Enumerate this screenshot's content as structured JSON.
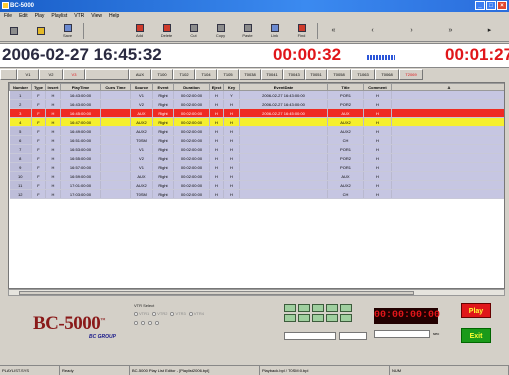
{
  "window": {
    "title": "BC-5000",
    "app_icon": "app-icon",
    "controls": [
      "_",
      "□",
      "×"
    ]
  },
  "menu": {
    "items": [
      "File",
      "Edit",
      "Play",
      "Playlist",
      "VTR",
      "View",
      "Help"
    ]
  },
  "toolbar": {
    "buttons": [
      {
        "label": "",
        "icon": "new-icon"
      },
      {
        "label": "",
        "icon": "open-icon"
      },
      {
        "label": "Save",
        "icon": "save-icon"
      },
      {
        "label": "Add",
        "icon": "add-icon"
      },
      {
        "label": "Delete",
        "icon": "delete-icon"
      },
      {
        "label": "Cut",
        "icon": "cut-icon"
      },
      {
        "label": "Copy",
        "icon": "copy-icon"
      },
      {
        "label": "Paste",
        "icon": "paste-icon"
      },
      {
        "label": "Link",
        "icon": "link-icon"
      },
      {
        "label": "Find",
        "icon": "find-icon"
      }
    ],
    "arrows": [
      "«",
      "‹",
      "›",
      "»",
      "▸"
    ]
  },
  "timebar": {
    "clock": "2006-02-27 16:45:32",
    "countdown": "00:00:32",
    "remaining": "00:01:27"
  },
  "column_bar": [
    {
      "label": "",
      "red": true
    },
    {
      "label": "V1",
      "red": false
    },
    {
      "label": "V2",
      "red": false
    },
    {
      "label": "V3",
      "red": true
    },
    {
      "label": "",
      "red": false
    },
    {
      "label": "AUX",
      "red": false
    },
    {
      "label": "T100",
      "red": false
    },
    {
      "label": "T102",
      "red": false
    },
    {
      "label": "T104",
      "red": false
    },
    {
      "label": "T105",
      "red": false
    },
    {
      "label": "T0038",
      "red": false
    },
    {
      "label": "T0041",
      "red": false
    },
    {
      "label": "T0043",
      "red": false
    },
    {
      "label": "T0051",
      "red": false
    },
    {
      "label": "T0058",
      "red": false
    },
    {
      "label": "T1063",
      "red": false
    },
    {
      "label": "T0068",
      "red": false
    },
    {
      "label": "T2069",
      "red": true
    }
  ],
  "table": {
    "headers": [
      "Number",
      "Type",
      "Insert",
      "PlayTime",
      "Cues Time",
      "Source",
      "Event",
      "Duration",
      "Eject",
      "Key",
      "EventDate",
      "Title",
      "Comment",
      "A"
    ],
    "rows": [
      {
        "style": "",
        "cells": [
          "1",
          "F",
          "H",
          "16:43:00:00",
          "",
          "V1",
          "Right",
          "00:02:00:00",
          "H",
          "Y",
          "2006-02-27 16:43:00:00",
          "POR1",
          "H",
          ""
        ]
      },
      {
        "style": "",
        "cells": [
          "2",
          "F",
          "H",
          "16:43:00:00",
          "",
          "V2",
          "Right",
          "00:02:00:00",
          "H",
          "H",
          "2006-02-27 16:43:00:00",
          "POR2",
          "H",
          ""
        ]
      },
      {
        "style": "red",
        "cells": [
          "3",
          "F",
          "H",
          "16:45:00:00",
          "",
          "AUX",
          "Right",
          "00:02:00:00",
          "H",
          "H",
          "2006-02-27 16:45:00:00",
          "AUX",
          "H",
          ""
        ]
      },
      {
        "style": "yellow",
        "cells": [
          "4",
          "F",
          "H",
          "16:47:00:00",
          "",
          "AUX2",
          "Right",
          "00:02:00:00",
          "H",
          "H",
          "",
          "AUX2",
          "H",
          ""
        ]
      },
      {
        "style": "",
        "cells": [
          "5",
          "F",
          "H",
          "16:49:00:00",
          "",
          "AUX2",
          "Right",
          "00:02:00:00",
          "H",
          "H",
          "",
          "AUX2",
          "H",
          ""
        ]
      },
      {
        "style": "",
        "cells": [
          "6",
          "F",
          "H",
          "16:51:00:00",
          "",
          "T0SM",
          "Right",
          "00:02:00:00",
          "H",
          "H",
          "",
          "CH",
          "H",
          ""
        ]
      },
      {
        "style": "",
        "cells": [
          "7",
          "F",
          "H",
          "16:53:00:00",
          "",
          "V1",
          "Right",
          "00:02:00:00",
          "H",
          "H",
          "",
          "POR1",
          "H",
          ""
        ]
      },
      {
        "style": "",
        "cells": [
          "8",
          "F",
          "H",
          "16:55:00:00",
          "",
          "V2",
          "Right",
          "00:02:00:00",
          "H",
          "H",
          "",
          "POR2",
          "H",
          ""
        ]
      },
      {
        "style": "",
        "cells": [
          "9",
          "F",
          "H",
          "16:57:00:00",
          "",
          "V1",
          "Right",
          "00:02:00:00",
          "H",
          "H",
          "",
          "POR1",
          "H",
          ""
        ]
      },
      {
        "style": "",
        "cells": [
          "10",
          "F",
          "H",
          "16:59:00:00",
          "",
          "AUX",
          "Right",
          "00:02:00:00",
          "H",
          "H",
          "",
          "AUX",
          "H",
          ""
        ]
      },
      {
        "style": "",
        "cells": [
          "11",
          "F",
          "H",
          "17:01:00:00",
          "",
          "AUX2",
          "Right",
          "00:02:00:00",
          "H",
          "H",
          "",
          "AUX2",
          "H",
          ""
        ]
      },
      {
        "style": "",
        "cells": [
          "12",
          "F",
          "H",
          "17:03:00:00",
          "",
          "T0SM",
          "Right",
          "00:02:00:00",
          "H",
          "H",
          "",
          "CH",
          "H",
          ""
        ]
      }
    ]
  },
  "bottom": {
    "logo": "BC-5000",
    "logo_tm": "™",
    "logo_sub": "BC GROUP",
    "vtr_title": "VTR Select",
    "vtr_options": [
      "VTR1",
      "VTR2",
      "VTR3",
      "VTR4"
    ],
    "counter": "00:00:00:00",
    "play_label": "Play",
    "exit_label": "Exit",
    "unit_label": "sec"
  },
  "status": [
    "PLAYLIST.SYS",
    "Ready",
    "BC-5000 Play List Editor - [Playlist2006.bpl]",
    "Playback.bpl / T0SM:0.bpl",
    "NUM"
  ]
}
